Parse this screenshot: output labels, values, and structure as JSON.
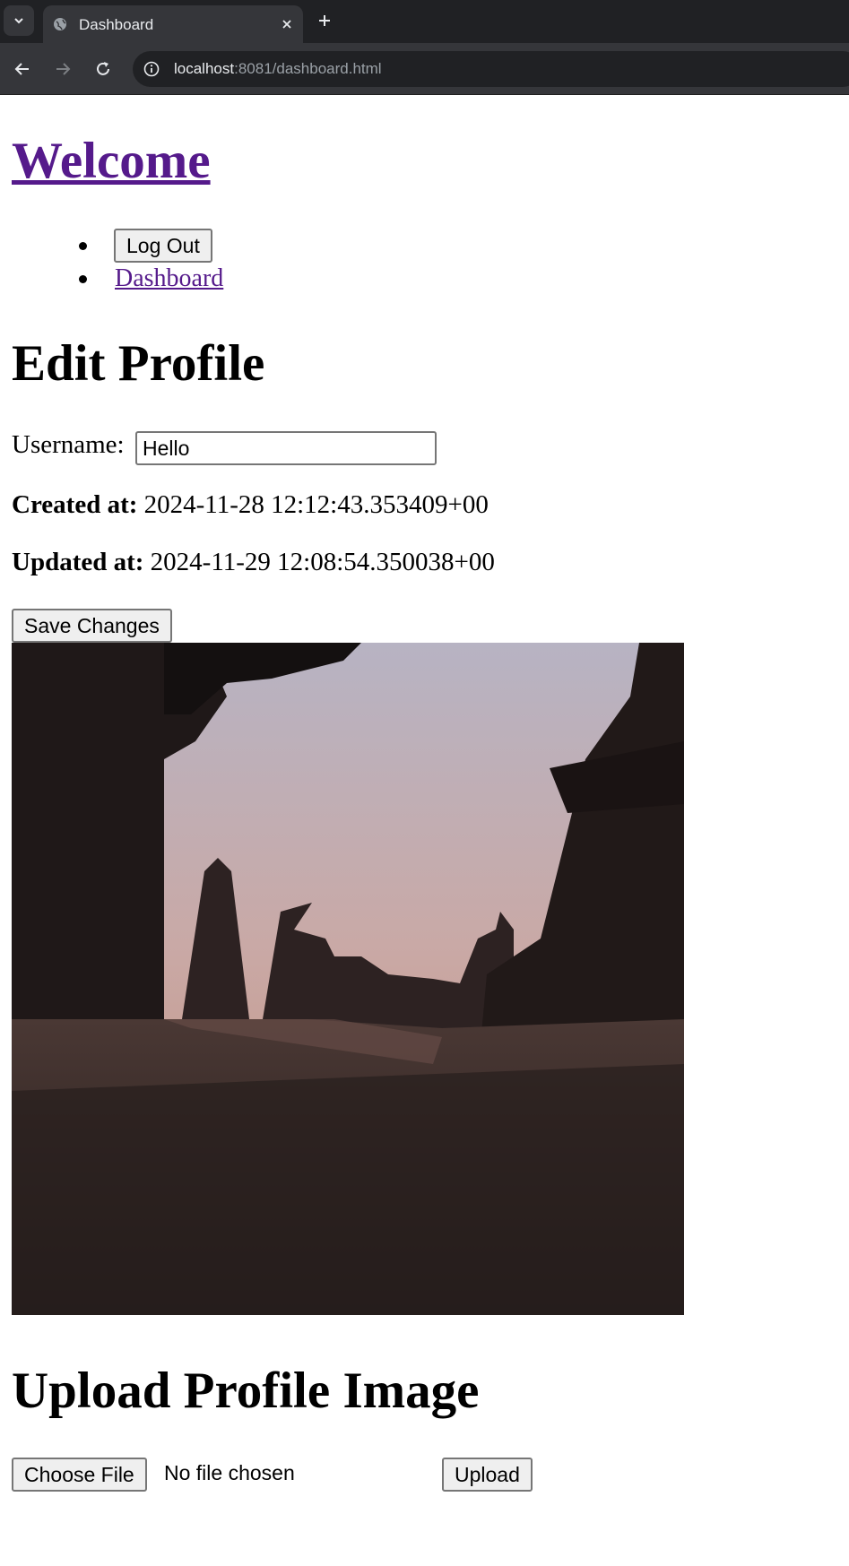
{
  "browser": {
    "tab_title": "Dashboard",
    "url_host": "localhost",
    "url_rest": ":8081/dashboard.html"
  },
  "page": {
    "welcome_link": "Welcome",
    "nav": {
      "logout_label": "Log Out",
      "dashboard_link": "Dashboard"
    },
    "edit_heading": "Edit Profile",
    "username_label": "Username:",
    "username_value": "Hello",
    "created_label": "Created at:",
    "created_value": "2024-11-28 12:12:43.353409+00",
    "updated_label": "Updated at:",
    "updated_value": "2024-11-29 12:08:54.350038+00",
    "save_label": "Save Changes",
    "upload_heading": "Upload Profile Image",
    "choose_file_label": "Choose File",
    "file_status": "No file chosen",
    "upload_label": "Upload"
  },
  "colors": {
    "visited_link": "#551a8b",
    "chrome_dark": "#202124",
    "chrome_tab": "#35363a"
  }
}
